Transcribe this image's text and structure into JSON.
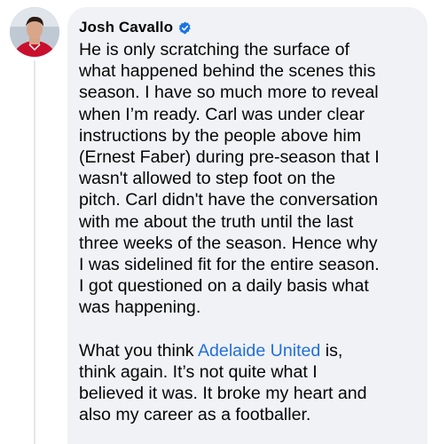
{
  "comment": {
    "author": "Josh Cavallo",
    "paragraph1_lines": [
      "He is only scratching the surface of",
      "what happened behind the scenes this",
      "season. I have so much more to reveal",
      "when I’m ready. Carl was under clear",
      "instructions by the people above him",
      "(Ernest Faber) during pre-season that I",
      "wasn't allowed to step foot on the",
      "pitch. Carl didn't have the conversation",
      "with me about the truth until the last",
      "three weeks of the season. Hence why",
      "I was sidelined fit for the entire season.",
      "I got questioned on a daily basis what",
      "was happening."
    ],
    "paragraph2_prefix": "What you think ",
    "paragraph2_link": "Adelaide United",
    "paragraph2_suffix": " is,",
    "paragraph2_lines": [
      "think again. It’s not quite what I",
      "believed it was. It broke my heart and",
      "also my career as a footballer."
    ]
  },
  "colors": {
    "bubble_bg": "#f0f2f5",
    "link": "#216fdb",
    "verified_badge": "#1b74e4"
  },
  "icons": {
    "verified": "verified-badge-icon",
    "avatar": "profile-photo"
  }
}
